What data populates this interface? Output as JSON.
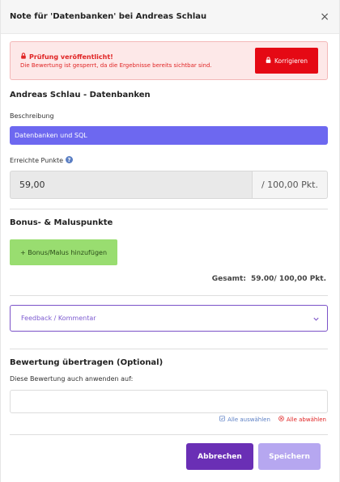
{
  "header": {
    "title": "Note für 'Datenbanken' bei Andreas Schlau",
    "close_glyph": "×"
  },
  "alert": {
    "title": "Prüfung veröffentlicht!",
    "message": "Die Bewertung ist gesperrt, da die Ergebnisse bereits sichtbar sind.",
    "button_label": "Korrigieren"
  },
  "student_section": {
    "title": "Andreas Schlau - Datenbanken"
  },
  "description": {
    "label": "Beschreibung",
    "value": "Datenbanken und SQL"
  },
  "points": {
    "label": "Erreichte Punkte",
    "value": "59,00",
    "max_label": "/ 100,00 Pkt."
  },
  "bonus": {
    "title": "Bonus- & Maluspunkte",
    "add_button": "+ Bonus/Malus hinzufügen"
  },
  "total": {
    "label": "Gesamt:",
    "value": "59.00/ 100,00 Pkt."
  },
  "feedback": {
    "placeholder": "Feedback / Kommentar"
  },
  "transfer": {
    "title": "Bewertung übertragen (Optional)",
    "label": "Diese Bewertung auch anwenden auf:",
    "input_value": "",
    "select_all": "Alle auswählen",
    "deselect_all": "Alle abwählen"
  },
  "footer": {
    "cancel": "Abbrechen",
    "save": "Speichern"
  },
  "colors": {
    "primary": "#6a2fb5",
    "primary_disabled": "#b6a7f0",
    "danger": "#e50914",
    "bonus_button": "#99dd70",
    "description_fill": "#6d68f0"
  }
}
